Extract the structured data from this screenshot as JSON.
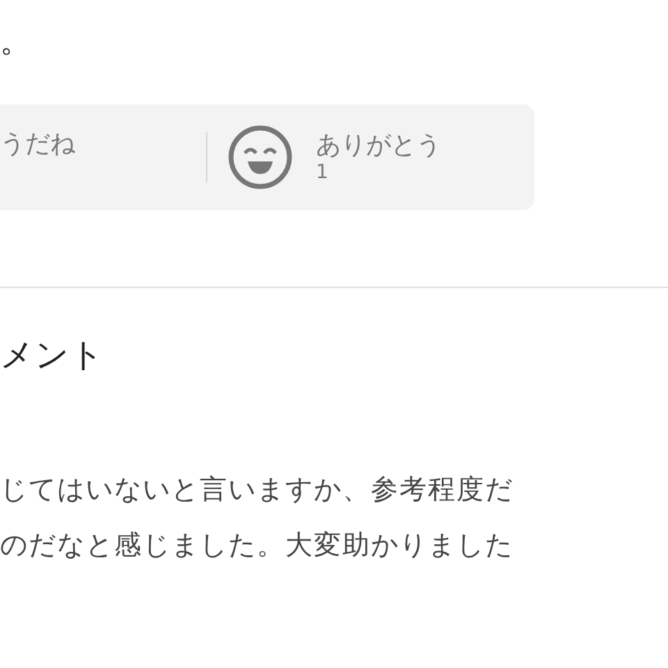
{
  "answer_tail": "。",
  "reactions": [
    {
      "kind": "text_only",
      "label": "うだね"
    },
    {
      "kind": "smile",
      "label": "ありがとう",
      "count": "1"
    }
  ],
  "comments": {
    "heading": "メント",
    "body_lines": [
      "じてはいないと言いますか、参考程度だ",
      "のだなと感じました。大変助かりました"
    ]
  }
}
